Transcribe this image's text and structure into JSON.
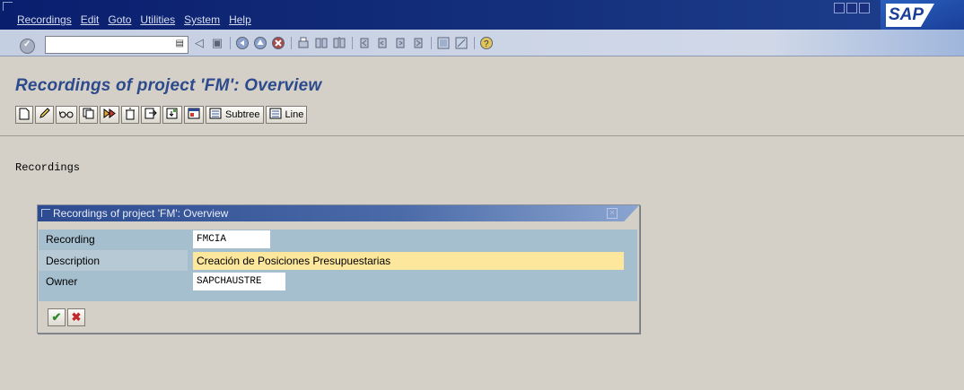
{
  "menu": {
    "items": [
      "Recordings",
      "Edit",
      "Goto",
      "Utilities",
      "System",
      "Help"
    ]
  },
  "branding": {
    "logo_text": "SAP"
  },
  "toolbar": {
    "command_field_value": "",
    "icons": [
      "enter",
      "save",
      "back",
      "exit",
      "cancel",
      "print",
      "find",
      "find-next",
      "first-page",
      "previous-page",
      "next-page",
      "last-page",
      "create-session",
      "shortcut",
      "help"
    ]
  },
  "page": {
    "title": "Recordings of project 'FM': Overview"
  },
  "app_toolbar": {
    "buttons": [
      "create",
      "change",
      "display",
      "copy",
      "process",
      "delete",
      "export",
      "import",
      "expand"
    ],
    "subtree_label": "Subtree",
    "line_label": "Line"
  },
  "main": {
    "label": "Recordings"
  },
  "dialog": {
    "title": "Recordings of project 'FM': Overview",
    "fields": [
      {
        "label": "Recording",
        "value": "FMCIA"
      },
      {
        "label": "Description",
        "value": "Creación de Posiciones Presupuestarias"
      },
      {
        "label": "Owner",
        "value": "SAPCHAUSTRE"
      }
    ],
    "colors": {
      "highlight": "#fde79c",
      "body": "#a6bfcf"
    }
  }
}
